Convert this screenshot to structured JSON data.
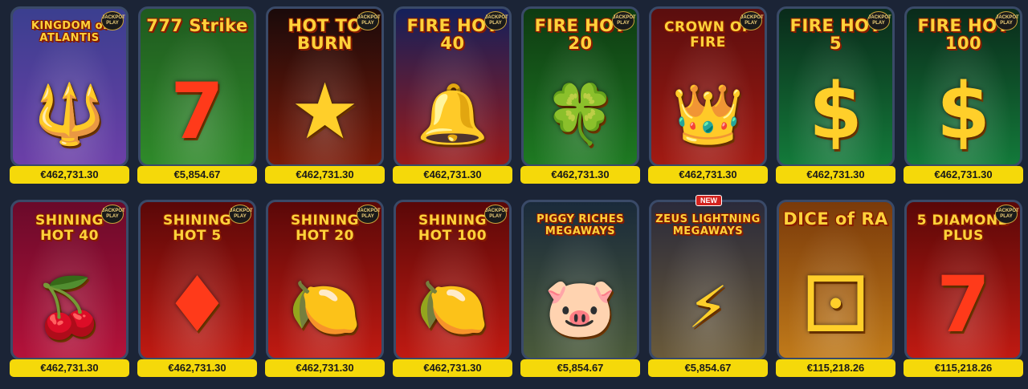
{
  "jackpot_badge": "JACKPOT PLAY",
  "new_badge": "NEW",
  "games": [
    {
      "title": "KINGDOM of ATLANTIS",
      "prize": "€462,731.30",
      "bg": "#3b3f8f",
      "bg2": "#6c3fa8",
      "icon": "trident-icon",
      "glyph": "🔱",
      "jackpot": true
    },
    {
      "title": "777 Strike",
      "prize": "€5,854.67",
      "bg": "#1f5a1f",
      "bg2": "#2f8a2a",
      "icon": "seven-icon",
      "glyph": "7",
      "jackpot": false
    },
    {
      "title": "HOT TO BURN",
      "prize": "€462,731.30",
      "bg": "#1a0a0a",
      "bg2": "#7a1a08",
      "icon": "star-icon",
      "glyph": "★",
      "jackpot": true
    },
    {
      "title": "FIRE HOT 40",
      "prize": "€462,731.30",
      "bg": "#14205a",
      "bg2": "#9a1a1a",
      "icon": "bell-icon",
      "glyph": "🔔",
      "jackpot": true
    },
    {
      "title": "FIRE HOT 20",
      "prize": "€462,731.30",
      "bg": "#0e3a12",
      "bg2": "#1e7a22",
      "icon": "clover-icon",
      "glyph": "🍀",
      "jackpot": true
    },
    {
      "title": "CROWN OF FIRE",
      "prize": "€462,731.30",
      "bg": "#5a0e0e",
      "bg2": "#a21a12",
      "icon": "crown-icon",
      "glyph": "👑",
      "jackpot": true
    },
    {
      "title": "FIRE HOT 5",
      "prize": "€462,731.30",
      "bg": "#0a2a1a",
      "bg2": "#137a3a",
      "icon": "dollar-icon",
      "glyph": "$",
      "jackpot": true
    },
    {
      "title": "FIRE HOT 100",
      "prize": "€462,731.30",
      "bg": "#0a2a1a",
      "bg2": "#137a3a",
      "icon": "dollar-icon",
      "glyph": "$",
      "jackpot": true
    },
    {
      "title": "SHINING HOT 40",
      "prize": "€462,731.30",
      "bg": "#6a0a2a",
      "bg2": "#b4123a",
      "icon": "cherry-icon",
      "glyph": "🍒",
      "jackpot": true
    },
    {
      "title": "SHINING HOT 5",
      "prize": "€462,731.30",
      "bg": "#5a0808",
      "bg2": "#c01a12",
      "icon": "diamond-icon",
      "glyph": "♦",
      "jackpot": true
    },
    {
      "title": "SHINING HOT 20",
      "prize": "€462,731.30",
      "bg": "#5a0808",
      "bg2": "#c01a12",
      "icon": "fruit-icon",
      "glyph": "🍋",
      "jackpot": true
    },
    {
      "title": "SHINING HOT 100",
      "prize": "€462,731.30",
      "bg": "#5a0808",
      "bg2": "#c01a12",
      "icon": "lemon-icon",
      "glyph": "🍋",
      "jackpot": true
    },
    {
      "title": "PIGGY RICHES MEGAWAYS",
      "prize": "€5,854.67",
      "bg": "#1a2a3a",
      "bg2": "#4a5a3a",
      "icon": "pig-icon",
      "glyph": "🐷",
      "jackpot": false
    },
    {
      "title": "ZEUS LIGHTNING MEGAWAYS",
      "prize": "€5,854.67",
      "bg": "#2a2a3a",
      "bg2": "#6a5a3a",
      "icon": "zeus-icon",
      "glyph": "⚡",
      "jackpot": false,
      "is_new": true
    },
    {
      "title": "DICE of RA",
      "prize": "€115,218.26",
      "bg": "#7a3a0a",
      "bg2": "#c07a1a",
      "icon": "dice-icon",
      "glyph": "⚀",
      "jackpot": false
    },
    {
      "title": "5 DIAMOND PLUS",
      "prize": "€115,218.26",
      "bg": "#5a0808",
      "bg2": "#c01a12",
      "icon": "seven-icon",
      "glyph": "7",
      "jackpot": true
    }
  ]
}
